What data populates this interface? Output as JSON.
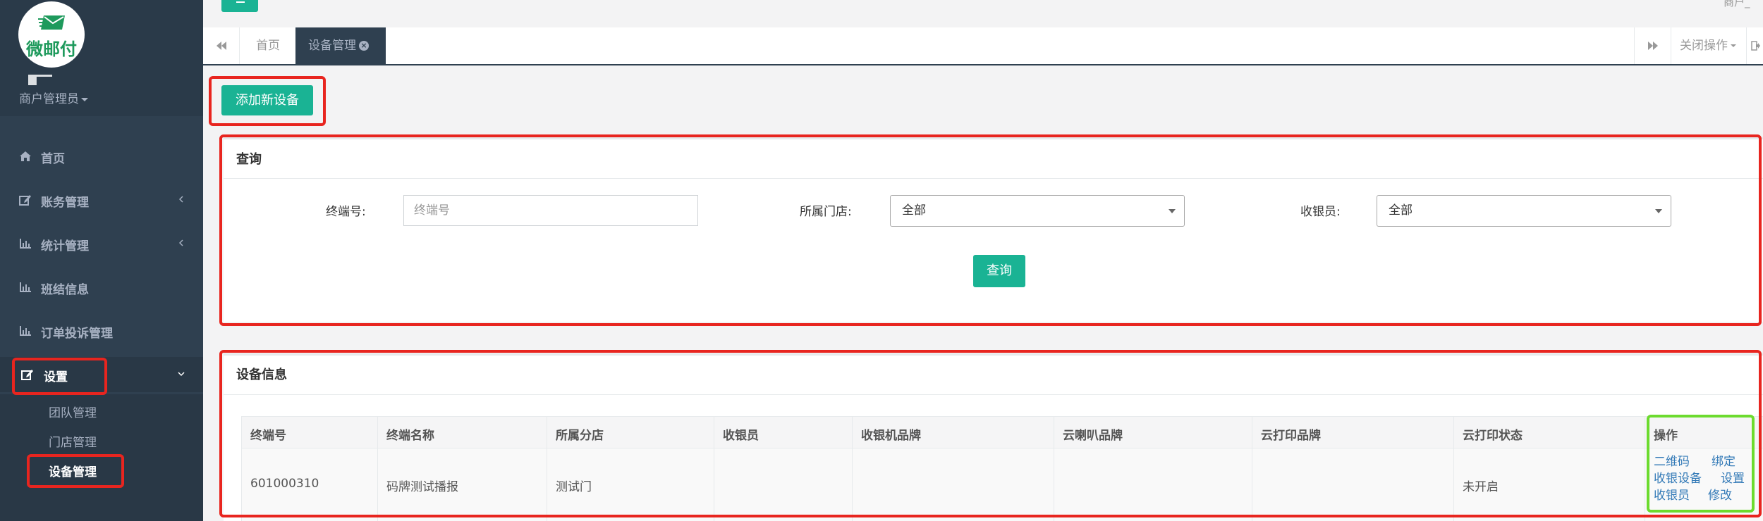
{
  "app": {
    "logo_text": "微邮付",
    "role": "商户管理员",
    "top_right_text": "商户_"
  },
  "sidebar": {
    "items": [
      {
        "label": "首页",
        "icon": "home-icon",
        "has_arrow": false
      },
      {
        "label": "账务管理",
        "icon": "edit-icon",
        "has_arrow": true
      },
      {
        "label": "统计管理",
        "icon": "bar-chart-icon",
        "has_arrow": true
      },
      {
        "label": "班结信息",
        "icon": "bar-chart-icon",
        "has_arrow": false
      },
      {
        "label": "订单投诉管理",
        "icon": "bar-chart-icon",
        "has_arrow": false
      },
      {
        "label": "设置",
        "icon": "edit-icon",
        "has_arrow": true,
        "expanded": true
      }
    ],
    "sub_items": [
      {
        "label": "团队管理"
      },
      {
        "label": "门店管理"
      },
      {
        "label": "设备管理",
        "active": true
      }
    ]
  },
  "tabs": {
    "items": [
      {
        "label": "首页"
      },
      {
        "label": "设备管理",
        "active": true
      }
    ],
    "close_ops_label": "关闭操作"
  },
  "actions": {
    "add_device_label": "添加新设备"
  },
  "query_panel": {
    "title": "查询",
    "terminal_label": "终端号:",
    "terminal_placeholder": "终端号",
    "store_label": "所属门店:",
    "store_value": "全部",
    "cashier_label": "收银员:",
    "cashier_value": "全部",
    "query_button": "查询"
  },
  "device_panel": {
    "title": "设备信息",
    "columns": [
      "终端号",
      "终端名称",
      "所属分店",
      "收银员",
      "收银机品牌",
      "云喇叭品牌",
      "云打印品牌",
      "云打印状态",
      "操作"
    ],
    "rows": [
      {
        "cells": [
          "601000310",
          "码牌测试播报",
          "测试门",
          "",
          "",
          "",
          "",
          "未开启"
        ],
        "actions": [
          "二维码",
          "绑定",
          "收银设备",
          "设置",
          "收银员",
          "修改"
        ]
      }
    ]
  },
  "colors": {
    "sidebar": "#2f4050",
    "accent": "#1ab394",
    "annotation_red": "#e8251f",
    "annotation_green": "#6cdb2e",
    "link": "#337ab7"
  }
}
